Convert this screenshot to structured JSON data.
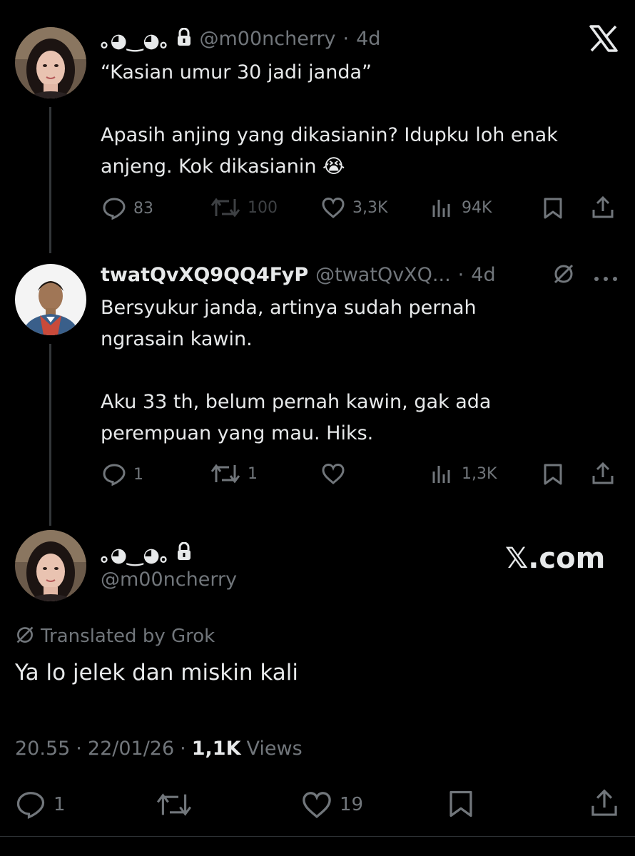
{
  "tweets": [
    {
      "display_name": "｡◕‿◕｡",
      "handle": "@m00ncherry",
      "time": "4d",
      "text": "“Kasian umur 30 jadi janda”\n\nApasih anjing yang dikasianin? Idupku loh enak\nanjeng. Kok dikasianin 😭",
      "actions": {
        "replies": "83",
        "reposts": "100",
        "likes": "3,3K",
        "views": "94K"
      }
    },
    {
      "display_name": "twatQvXQ9QQ4FyP",
      "handle": "@twatQvXQ...",
      "time": "4d",
      "text": "Bersyukur janda, artinya sudah pernah\nngrasain kawin.\n\nAku 33 th, belum pernah kawin, gak ada\nperempuan yang mau. Hiks.",
      "actions": {
        "replies": "1",
        "reposts": "1",
        "likes": "",
        "views": "1,3K"
      }
    }
  ],
  "main": {
    "display_name": "｡◕‿◕｡",
    "handle": "@m00ncherry",
    "brand": "𝕏.com",
    "translated_label": "Translated by Grok",
    "text": "Ya lo jelek dan miskin kali",
    "time": "20.55",
    "date": "22/01/26",
    "views_count": "1,1K",
    "views_label": "Views",
    "actions": {
      "replies": "1",
      "reposts": "",
      "likes": "19"
    }
  },
  "sep": "·",
  "colors": {
    "bg": "#000000",
    "text": "#e7e9ea",
    "muted": "#71767b",
    "line": "#333639"
  },
  "icons": [
    "x-logo-icon",
    "lock-icon",
    "reply-icon",
    "repost-icon",
    "like-icon",
    "views-icon",
    "bookmark-icon",
    "share-icon",
    "grok-translate-icon",
    "more-icon"
  ]
}
